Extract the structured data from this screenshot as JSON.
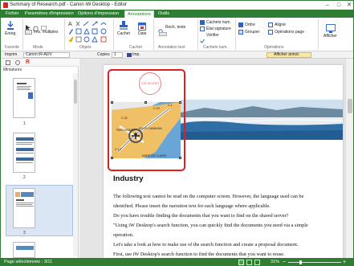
{
  "window": {
    "title": "Summary of Research.pdf - Canon iW Desktop - Editor"
  },
  "tabs": [
    {
      "label": "Fichier"
    },
    {
      "label": "Paramètres d'impression"
    },
    {
      "label": "Options d'impression"
    },
    {
      "label": "Annotations",
      "active": true
    },
    {
      "label": "Outils"
    }
  ],
  "ribbon": {
    "enreg": "Enreg.",
    "favorite": "Favorite",
    "mode": "Mode",
    "ims_multiples": "Ims. multiples",
    "objets": "Objets",
    "cachet_btn": "Cachet",
    "date_btn": "Date",
    "cachet_group": "Cachet",
    "rech_texte": "Rech. texte",
    "annotation_text": "Annotation text",
    "cachets_num": "Cachets num.",
    "etat_signature": "État signature",
    "verifier": "Vérifier",
    "cachets_num_group": "Cachets num.",
    "ordre": "Ordre",
    "aligne": "Aligné",
    "grouper": "Grouper",
    "operations_page": "Opérations page",
    "operations": "Opérations",
    "afficher": "Afficher"
  },
  "toolbar": {
    "imprimer": "Imprim",
    "printer": "Canon iR-ADV",
    "copies_label": "Copies",
    "copies_value": "1",
    "imp_label": "Imp.",
    "afficher_annot": "Afficher annot."
  },
  "sidebar": {
    "header": "Miniatures",
    "pages": [
      "1",
      "2",
      "3"
    ]
  },
  "document": {
    "stamp": "TOP SECRET",
    "heading": "Industry",
    "map_labels": [
      "C-1",
      "C-12",
      "C-23",
      "C-32",
      "RYOKOKUMI",
      "KR LE CABANNA",
      "PARCMONTE",
      "MARE DE CLAIRE"
    ],
    "lines": [
      "The following text cannot be read on the computer screen. However, the language used can be",
      "identified. Please insert the narration text for each language where applicable.",
      "Do you have trouble finding the documents that you want to find on the shared server?",
      "\"Using iW Desktop's search function, you can quickly find the documents you need via a simple",
      "operation.",
      "Let's take a look at how to make use of the search function and create a proposal document.",
      "First, use iW Desktop's search function to find the documents that you want to reuse."
    ]
  },
  "statusbar": {
    "page_info": "Page sélectionnée : 3/11",
    "zoom": "31%"
  },
  "colors": {
    "accent": "#2e7d32",
    "highlight": "#e02020"
  }
}
